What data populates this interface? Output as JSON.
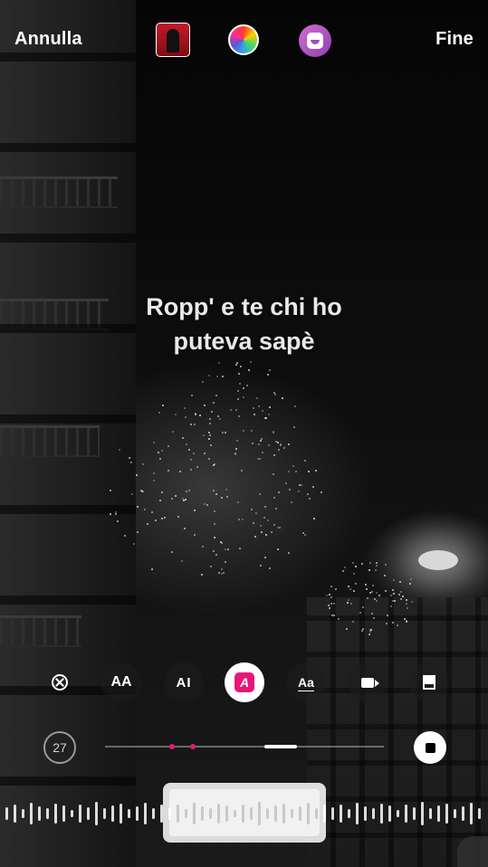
{
  "top_bar": {
    "cancel_label": "Annulla",
    "done_label": "Fine",
    "album_icon": "album-cover",
    "color_icon": "color-wheel-icon",
    "sticker_icon": "sticker-face-icon"
  },
  "lyrics": {
    "line1": "Ropp' e te chi ho",
    "line2": "puteva sapè"
  },
  "style_options": [
    {
      "name": "remove",
      "icon": "close-circle-icon"
    },
    {
      "name": "typewriter",
      "glyph": "AA"
    },
    {
      "name": "cursor",
      "glyph": "AI"
    },
    {
      "name": "highlight",
      "glyph": "A",
      "selected": true
    },
    {
      "name": "underline",
      "glyph": "Aa"
    },
    {
      "name": "video",
      "icon": "video-icon"
    },
    {
      "name": "card",
      "icon": "card-icon"
    }
  ],
  "timeline": {
    "clip_duration": "27",
    "playback_icon": "stop-icon"
  },
  "colors": {
    "accent": "#e6177a",
    "background": "#0b0b0b",
    "text": "#ffffff"
  }
}
